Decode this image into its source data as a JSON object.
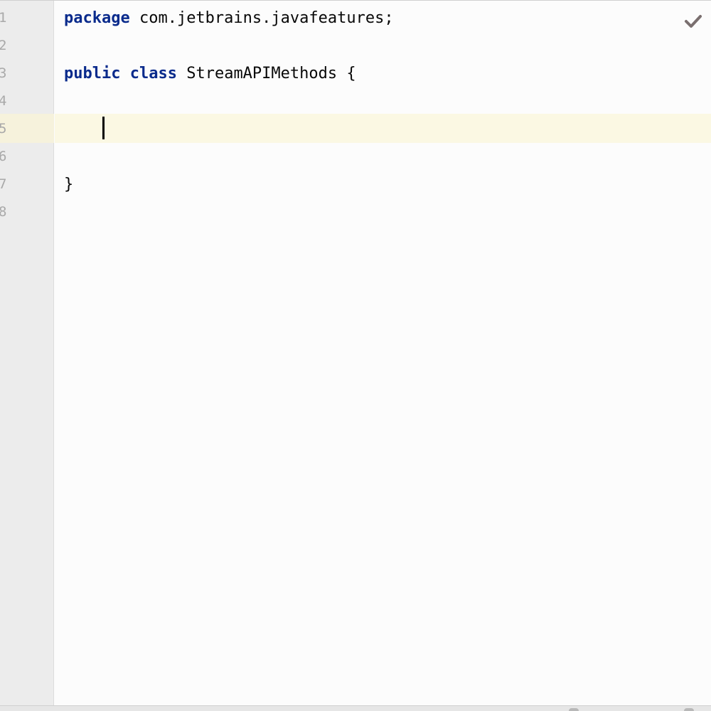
{
  "editor": {
    "line_numbers": [
      "1",
      "2",
      "3",
      "4",
      "5",
      "6",
      "7",
      "8"
    ],
    "lines": {
      "l1": {
        "keyword": "package",
        "rest": " com.jetbrains.javafeatures;"
      },
      "l3": {
        "kw1": "public",
        "kw2": "class",
        "rest": " StreamAPIMethods {"
      },
      "l7": {
        "text": "}"
      }
    },
    "current_line": 5,
    "status_icon": "check-icon",
    "colors": {
      "keyword": "#0a2b8c",
      "current_line_highlight": "#fbf8e3",
      "gutter": "#ececec",
      "check": "#7a6f6f"
    }
  }
}
